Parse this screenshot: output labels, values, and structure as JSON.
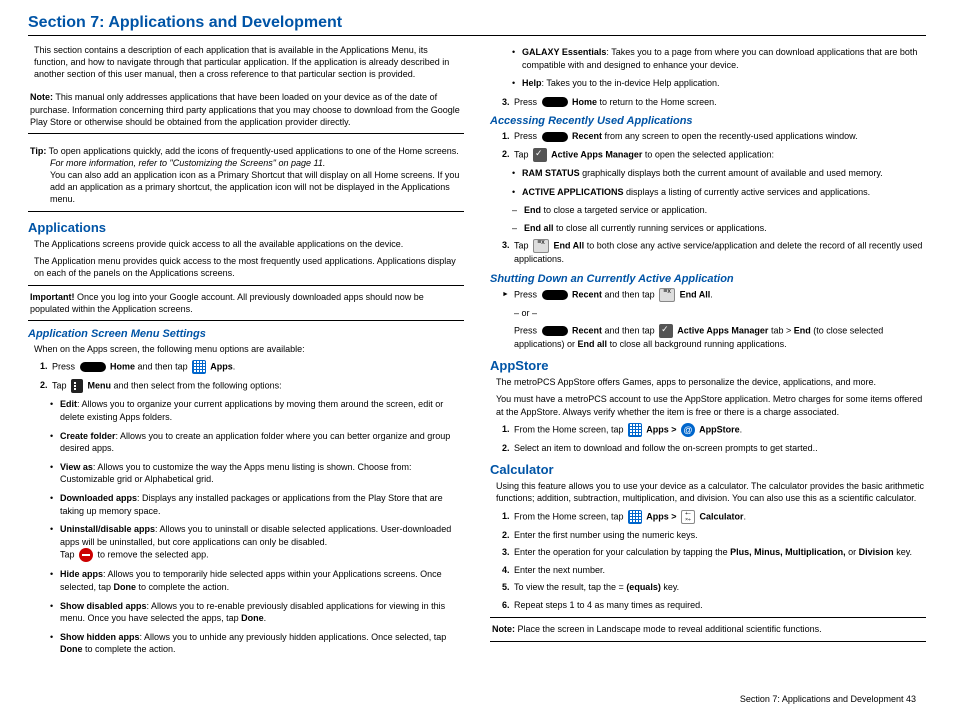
{
  "sectionTitle": "Section 7: Applications and Development",
  "intro": "This section contains a description of each application that is available in the Applications Menu, its function, and how to navigate through that particular application. If the application is already described in another section of this user manual, then a cross reference to that particular section is provided.",
  "noteLabel": "Note:",
  "noteText": " This manual only addresses applications that have been loaded on your device as of the date of purchase. Information concerning third party applications that you may choose to download from the Google Play Store or otherwise should be obtained from the application provider directly.",
  "tipLabel": "Tip:",
  "tipLine1": " To open applications quickly, add the icons of frequently-used applications to one of the Home screens. ",
  "tipLine2": "For more information, refer to \"Customizing the Screens\" on page 11.",
  "tipLine3": "You can also add an application icon as a Primary Shortcut that will display on all Home screens. If you add an application as a primary shortcut, the application icon will not be displayed in the Applications menu.",
  "appsHeading": "Applications",
  "appsP1": "The Applications screens provide quick access to all the available applications on the device.",
  "appsP2": "The Application menu provides quick access to the most frequently used applications. Applications display on each of the panels on the Applications screens.",
  "importantLabel": "Important!",
  "importantText": " Once you log into your Google account. All previously downloaded apps should now be populated within the Application screens.",
  "menuSettingsHeading": "Application Screen Menu Settings",
  "menuSettingsIntro": "When on the Apps screen, the following menu options are available:",
  "press": "Press ",
  "tap": "Tap ",
  "home": " Home",
  "andThenTap": " and then tap ",
  "apps": " Apps",
  "menu": " Menu",
  "menuTail": " and then select from the following options:",
  "editLabel": "Edit",
  "editText": ": Allows you to organize your current applications by moving them around the screen, edit or delete existing Apps folders.",
  "createFolderLabel": "Create folder",
  "createFolderText": ": Allows you to create an application folder where you can better organize and group desired apps.",
  "viewAsLabel": "View as",
  "viewAsText": ": Allows you to customize the way the Apps menu listing is shown. Choose from: Customizable grid or Alphabetical grid.",
  "downloadedLabel": "Downloaded apps",
  "downloadedText": ": Displays any installed packages or applications from the Play Store that are taking up memory space.",
  "uninstallLabel": "Uninstall/disable apps",
  "uninstallText": ": Allows you to uninstall or disable selected applications. User-downloaded apps will be uninstalled, but core applications can only be disabled.",
  "uninstallTapTail": " to remove the selected app.",
  "hideLabel": "Hide apps",
  "hideText": ": Allows you to temporarily hide selected apps within your Applications screens. Once selected, tap ",
  "done": "Done",
  "hideTail": " to complete the action.",
  "showDisabledLabel": "Show disabled apps",
  "showDisabledText": ": Allows you to re-enable previously disabled applications for viewing in this menu. Once you have selected the apps, tap ",
  "showHiddenLabel": "Show hidden apps",
  "showHiddenText": ": Allows you to unhide any previously hidden applications. Once selected, tap ",
  "galaxyLabel": "GALAXY Essentials",
  "galaxyText": ": Takes you to a page from where you can download applications that are both compatible with and designed to enhance your device.",
  "helpLabel": "Help",
  "helpText": ": Takes you to the in-device Help application.",
  "pressHomeReturn": " to return to the Home screen.",
  "recentHeading": "Accessing Recently Used Applications",
  "recent": " Recent",
  "recentTail": " from any screen to open the recently-used applications window.",
  "activeAppsMgr": " Active Apps Manager",
  "activeAppsTail": " to open the selected application:",
  "ramLabel": "RAM STATUS",
  "ramText": " graphically displays both the current amount of available and used memory.",
  "activeAppsLabel": "ACTIVE APPLICATIONS",
  "activeAppsText": " displays a listing of currently active services and applications.",
  "endLabel": "End",
  "endText": " to close a targeted service or application.",
  "endAllLabel": "End all",
  "endAllText": " to close all currently running services or applications.",
  "endAllBtn": " End All",
  "endAllTail": " to both close any active service/application and delete the record of all recently used applications.",
  "shutdownHeading": "Shutting Down an Currently Active Application",
  "or": "– or –",
  "tabEnd": " tab > ",
  "tabEndLabel": "End",
  "tabEndTail": " (to close selected applications) or ",
  "endAllBg": " to close all background running applications.",
  "appstoreHeading": "AppStore",
  "appstoreP1": "The metroPCS AppStore offers Games, apps to personalize the device, applications, and more.",
  "appstoreP2": "You must have a metroPCS account to use the AppStore application. Metro charges for some items offered at the AppStore. Always verify whether the item is free or there is a charge associated.",
  "fromHome": "From the Home screen, tap ",
  "appsArrow": " Apps > ",
  "appstore": " AppStore",
  "appstoreStep2": "Select an item to download and follow the on-screen prompts to get started..",
  "calcHeading": "Calculator",
  "calcIntro": "Using this feature allows you to use your device as a calculator. The calculator provides the basic arithmetic functions; addition, subtraction, multiplication, and division. You can also use this as a scientific calculator.",
  "calculator": " Calculator",
  "calcS2": "Enter the first number using the numeric keys.",
  "calcS3a": "Enter the operation for your calculation by tapping the ",
  "calcS3b": "Plus, Minus, Multiplication,",
  "calcS3c": " or ",
  "calcS3d": "Division",
  "calcS3e": " key.",
  "calcS4": "Enter the next number.",
  "calcS5a": "To view the result, tap the = ",
  "calcS5b": " (equals)",
  "calcS5c": " key.",
  "calcS6": "Repeat steps 1 to 4 as many times as required.",
  "calcNote": " Place the screen in Landscape mode to reveal additional scientific functions.",
  "footer": "Section 7:  Applications and Development   43"
}
